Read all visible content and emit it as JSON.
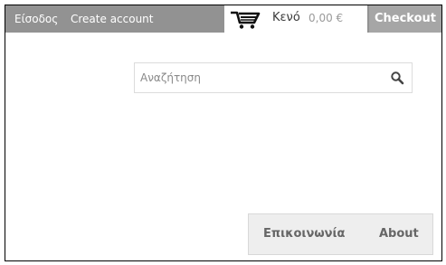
{
  "topbar": {
    "login_label": "Είσοδος",
    "create_account_label": "Create account",
    "cart": {
      "icon": "shopping-cart-icon",
      "status": "Κενό",
      "total": "0,00 €"
    },
    "checkout_label": "Checkout"
  },
  "search": {
    "placeholder": "Αναζήτηση",
    "icon": "search-icon"
  },
  "footer_nav": {
    "items": [
      {
        "label": "Επικοινωνία"
      },
      {
        "label": "About"
      }
    ]
  },
  "colors": {
    "topbar_background": "#929292",
    "checkout_background": "#a6a6a6",
    "nav_background": "#eeeeee"
  }
}
